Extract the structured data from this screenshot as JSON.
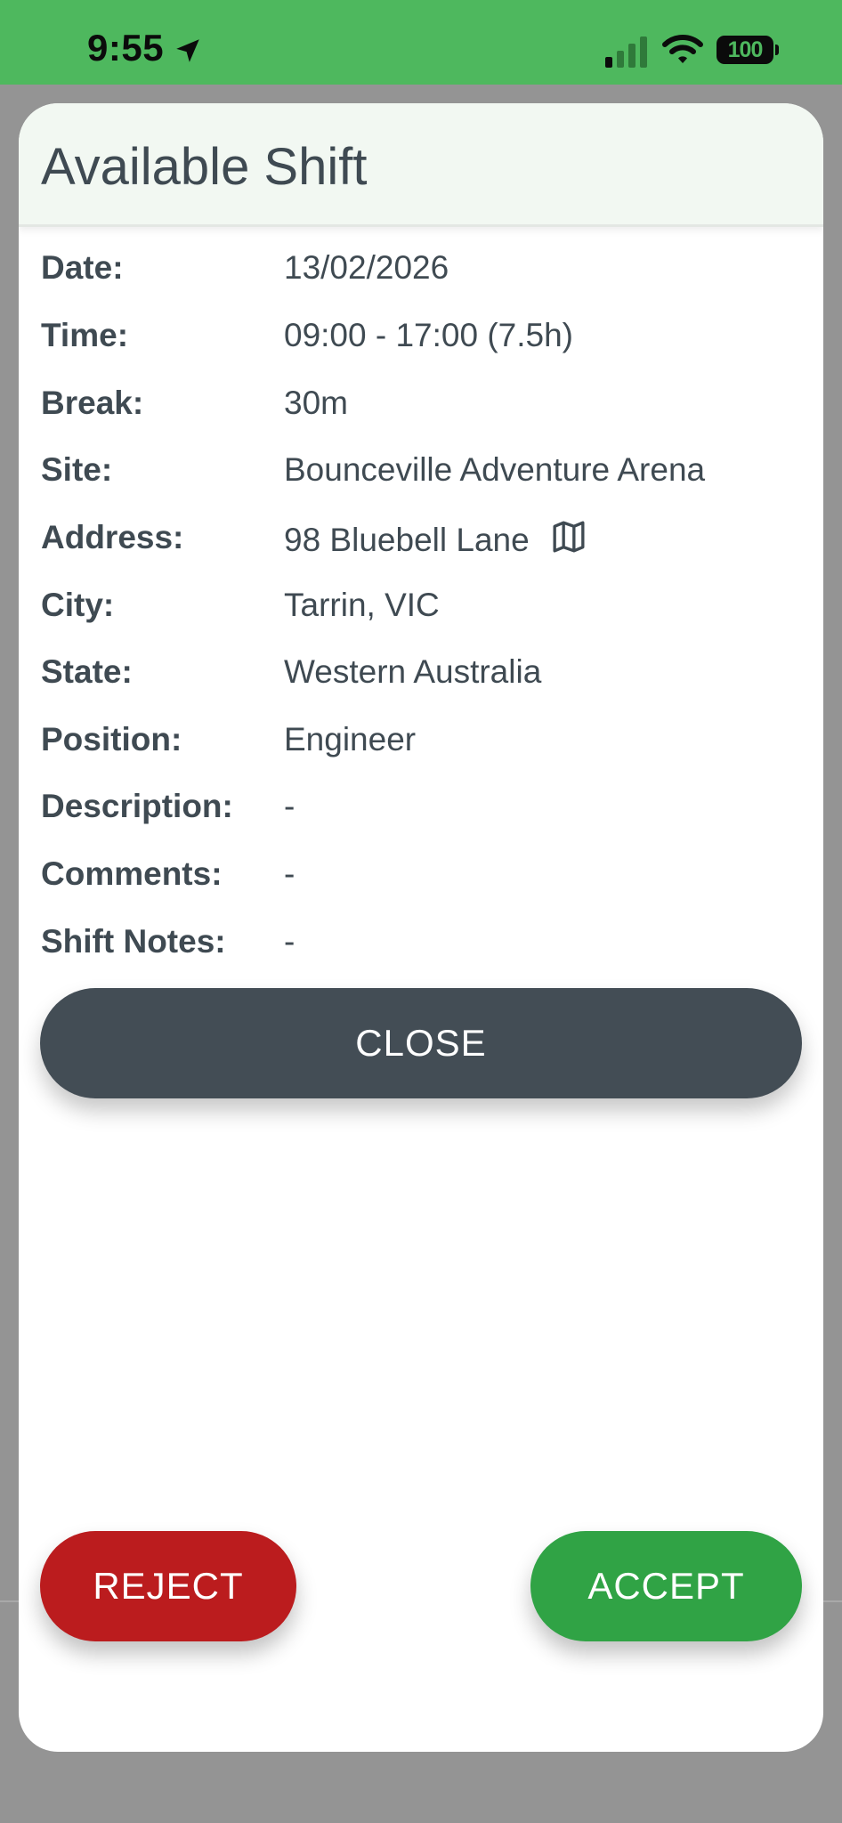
{
  "status_bar": {
    "time": "9:55",
    "battery": "100",
    "icons": [
      "location-arrow-icon",
      "cellular-signal-icon",
      "wifi-icon",
      "battery-icon"
    ],
    "background": "#4eb85e"
  },
  "dialog": {
    "title": "Available Shift",
    "header_background": "#f2f8f2",
    "text_color": "#3f4a52",
    "details": [
      {
        "label": "Date:",
        "value": "13/02/2026"
      },
      {
        "label": "Time:",
        "value": "09:00 - 17:00 (7.5h)"
      },
      {
        "label": "Break:",
        "value": "30m"
      },
      {
        "label": "Site:",
        "value": "Bounceville Adventure Arena"
      },
      {
        "label": "Address:",
        "value": "98 Bluebell Lane",
        "icon": "map-icon"
      },
      {
        "label": "City:",
        "value": "Tarrin, VIC"
      },
      {
        "label": "State:",
        "value": "Western Australia"
      },
      {
        "label": "Position:",
        "value": "Engineer"
      },
      {
        "label": "Description:",
        "value": "-"
      },
      {
        "label": "Comments:",
        "value": "-"
      },
      {
        "label": "Shift Notes:",
        "value": "-"
      }
    ],
    "close_label": "CLOSE",
    "close_color": "#434d55"
  },
  "actions": {
    "reject_label": "REJECT",
    "reject_color": "#bb1c1e",
    "accept_label": "ACCEPT",
    "accept_color": "#30a345"
  }
}
